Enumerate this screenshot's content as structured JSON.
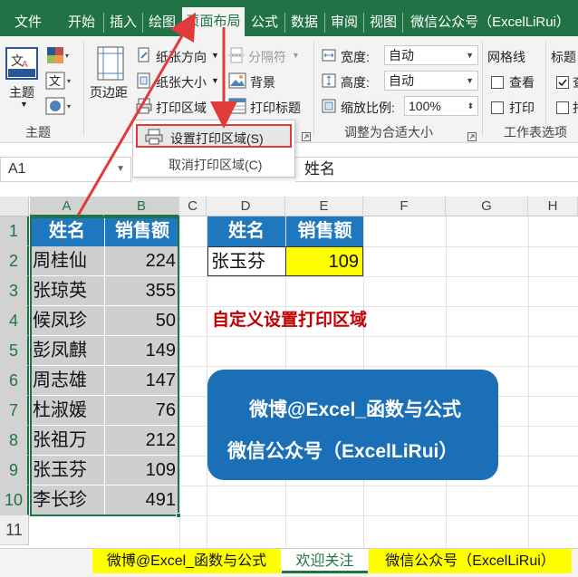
{
  "ribbon_tabs": [
    "文件",
    "开始",
    "插入",
    "绘图",
    "页面布局",
    "公式",
    "数据",
    "审阅",
    "视图",
    "微信公众号（ExcelLiRui）"
  ],
  "ribbon": {
    "themes": {
      "label": "主题",
      "group": "主题"
    },
    "margins": "页边距",
    "orientation": "纸张方向",
    "size": "纸张大小",
    "print_area": "打印区域",
    "breaks": "分隔符",
    "background": "背景",
    "print_titles": "打印标题",
    "width_label": "宽度:",
    "width_value": "自动",
    "height_label": "高度:",
    "height_value": "自动",
    "scale_label": "缩放比例:",
    "scale_value": "100%",
    "scale_group": "调整为合适大小",
    "gridlines": "网格线",
    "headings": "标题",
    "view": "查看",
    "print": "打印",
    "sheet_options_group": "工作表选项",
    "view_short": "查",
    "print_short": "打"
  },
  "menu": {
    "set_print_area": "设置打印区域(S)",
    "clear_print_area": "取消打印区域(C)"
  },
  "name_box": "A1",
  "formula_value": "姓名",
  "columns": [
    "A",
    "B",
    "C",
    "D",
    "E",
    "F",
    "G",
    "H"
  ],
  "rows": [
    "1",
    "2",
    "3",
    "4",
    "5",
    "6",
    "7",
    "8",
    "9",
    "10",
    "11"
  ],
  "table1": {
    "headers": [
      "姓名",
      "销售额"
    ],
    "rows": [
      [
        "周桂仙",
        "224"
      ],
      [
        "张琼英",
        "355"
      ],
      [
        "候凤珍",
        "50"
      ],
      [
        "彭凤麒",
        "149"
      ],
      [
        "周志雄",
        "147"
      ],
      [
        "杜淑媛",
        "76"
      ],
      [
        "张祖万",
        "212"
      ],
      [
        "张玉芬",
        "109"
      ],
      [
        "李长珍",
        "491"
      ]
    ]
  },
  "table2": {
    "headers": [
      "姓名",
      "销售额"
    ],
    "name": "张玉芬",
    "value": "109"
  },
  "annotation_title": "自定义设置打印区域",
  "promo": {
    "line1": "微博@Excel_函数与公式",
    "line2": "微信公众号（ExcelLiRui）"
  },
  "sheet_tabs": [
    "微博@Excel_函数与公式",
    "欢迎关注",
    "微信公众号（ExcelLiRui）"
  ],
  "colors": {
    "excel_green": "#217346",
    "header_blue": "#1f78bd",
    "highlight_yellow": "#ffff00",
    "annotation_red": "#e03b3b",
    "title_red": "#c00000"
  }
}
